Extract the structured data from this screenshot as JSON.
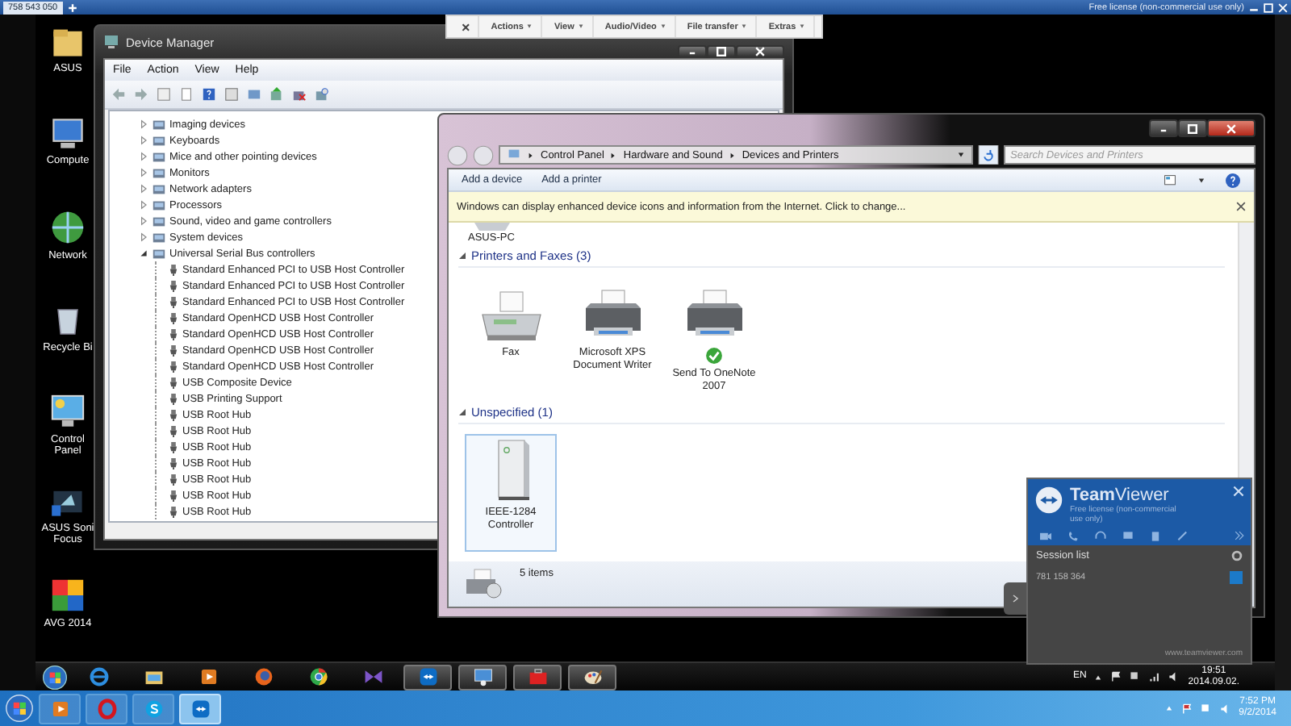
{
  "session_tab": {
    "label": "758 543 050"
  },
  "license_note": "Free license (non-commercial use only)",
  "remote_toolbar": [
    {
      "label": "×",
      "kind": "close"
    },
    {
      "label": "Actions",
      "kind": "menu"
    },
    {
      "label": "View",
      "kind": "menu"
    },
    {
      "label": "Audio/Video",
      "kind": "menu"
    },
    {
      "label": "File transfer",
      "kind": "menu"
    },
    {
      "label": "Extras",
      "kind": "menu"
    }
  ],
  "desktop_icons": [
    {
      "label": "ASUS",
      "kind": "folder"
    },
    {
      "label": "Compute",
      "kind": "computer"
    },
    {
      "label": "Network",
      "kind": "network"
    },
    {
      "label": "Recycle Bi",
      "kind": "bin"
    },
    {
      "label": "Control Panel",
      "kind": "panel"
    },
    {
      "label": "ASUS Soni Focus",
      "kind": "audio"
    },
    {
      "label": "AVG 2014",
      "kind": "avg"
    }
  ],
  "device_manager": {
    "title": "Device Manager",
    "menu": [
      "File",
      "Action",
      "View",
      "Help"
    ],
    "tree": [
      {
        "label": "Imaging devices",
        "expanded": false
      },
      {
        "label": "Keyboards",
        "expanded": false
      },
      {
        "label": "Mice and other pointing devices",
        "expanded": false
      },
      {
        "label": "Monitors",
        "expanded": false
      },
      {
        "label": "Network adapters",
        "expanded": false
      },
      {
        "label": "Processors",
        "expanded": false
      },
      {
        "label": "Sound, video and game controllers",
        "expanded": false
      },
      {
        "label": "System devices",
        "expanded": false
      },
      {
        "label": "Universal Serial Bus controllers",
        "expanded": true,
        "children": [
          {
            "label": "Standard Enhanced PCI to USB Host Controller"
          },
          {
            "label": "Standard Enhanced PCI to USB Host Controller"
          },
          {
            "label": "Standard Enhanced PCI to USB Host Controller"
          },
          {
            "label": "Standard OpenHCD USB Host Controller"
          },
          {
            "label": "Standard OpenHCD USB Host Controller"
          },
          {
            "label": "Standard OpenHCD USB Host Controller"
          },
          {
            "label": "Standard OpenHCD USB Host Controller"
          },
          {
            "label": "USB Composite Device"
          },
          {
            "label": "USB Printing Support"
          },
          {
            "label": "USB Root Hub"
          },
          {
            "label": "USB Root Hub"
          },
          {
            "label": "USB Root Hub"
          },
          {
            "label": "USB Root Hub"
          },
          {
            "label": "USB Root Hub"
          },
          {
            "label": "USB Root Hub"
          },
          {
            "label": "USB Root Hub"
          }
        ]
      }
    ]
  },
  "devices_printers": {
    "breadcrumb": [
      "Control Panel",
      "Hardware and Sound",
      "Devices and Printers"
    ],
    "search": {
      "placeholder": "Search Devices and Printers"
    },
    "commands": [
      "Add a device",
      "Add a printer"
    ],
    "info_bar": "Windows can display enhanced device icons and information from the Internet. Click to change...",
    "top_item": "ASUS-PC",
    "groups": [
      {
        "title": "Printers and Faxes (3)",
        "expanded": true,
        "items": [
          {
            "label": "Fax",
            "kind": "fax",
            "default": false,
            "selected": false
          },
          {
            "label": "Microsoft XPS Document Writer",
            "kind": "printer",
            "default": false,
            "selected": false
          },
          {
            "label": "Send To OneNote 2007",
            "kind": "printer",
            "default": true,
            "selected": false
          }
        ]
      },
      {
        "title": "Unspecified (1)",
        "expanded": true,
        "items": [
          {
            "label": "IEEE-1284 Controller",
            "kind": "tower",
            "default": false,
            "selected": true
          }
        ]
      }
    ],
    "status": "5 items"
  },
  "teamviewer_panel": {
    "title": "**Team**Viewer",
    "subtitle": "Free license (non-commercial use only)",
    "session_list": "Session list",
    "session_id": "781 158 364",
    "footer": "www.teamviewer.com"
  },
  "remote_taskbar": {
    "items": [
      {
        "kind": "ie",
        "running": false
      },
      {
        "kind": "folder",
        "running": false
      },
      {
        "kind": "media",
        "running": false
      },
      {
        "kind": "firefox",
        "running": false
      },
      {
        "kind": "chrome",
        "running": false
      },
      {
        "kind": "vs",
        "running": false
      },
      {
        "kind": "teamviewer",
        "running": true
      },
      {
        "kind": "devices",
        "running": true
      },
      {
        "kind": "toolbox",
        "running": true
      },
      {
        "kind": "paint",
        "running": true
      }
    ],
    "language": "EN",
    "time": "19:51",
    "date": "2014.09.02."
  },
  "local_taskbar": {
    "items": [
      {
        "kind": "media",
        "running": false
      },
      {
        "kind": "opera",
        "running": false
      },
      {
        "kind": "skype",
        "running": false
      },
      {
        "kind": "teamviewer",
        "running": true
      }
    ],
    "time": "7:52 PM",
    "date": "9/2/2014"
  }
}
